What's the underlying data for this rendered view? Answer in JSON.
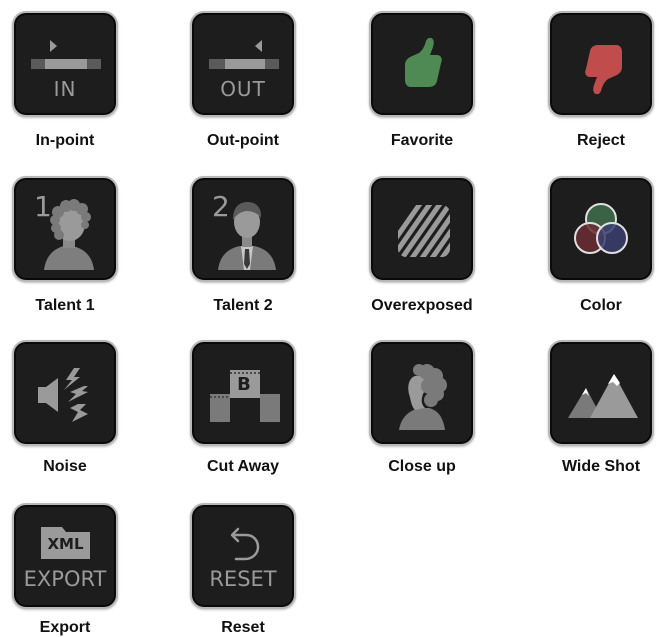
{
  "buttons": [
    {
      "label": "In-point",
      "key_text": "IN"
    },
    {
      "label": "Out-point",
      "key_text": "OUT"
    },
    {
      "label": "Favorite"
    },
    {
      "label": "Reject"
    },
    {
      "label": "Talent 1",
      "key_text": "1"
    },
    {
      "label": "Talent 2",
      "key_text": "2"
    },
    {
      "label": "Overexposed"
    },
    {
      "label": "Color"
    },
    {
      "label": "Noise"
    },
    {
      "label": "Cut Away",
      "key_text": "B"
    },
    {
      "label": "Close up"
    },
    {
      "label": "Wide Shot"
    },
    {
      "label": "Export",
      "key_text": "EXPORT",
      "badge_text": "XML"
    },
    {
      "label": "Reset",
      "key_text": "RESET"
    }
  ],
  "colors": {
    "key_face": "#1d1d1d",
    "key_border": "#b8b8b8",
    "icon_gray": "#9a9a9a",
    "favorite_green": "#4f8a55",
    "reject_red": "#c04c4c",
    "color_green": "#3f6a4a",
    "color_red": "#6b2e34",
    "color_blue": "#3b3f6e"
  }
}
